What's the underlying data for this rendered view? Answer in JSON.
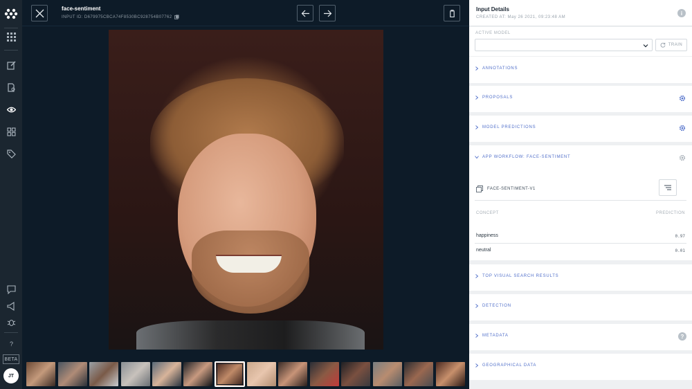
{
  "viewer": {
    "title": "face-sentiment",
    "input_id": "INPUT ID: D679975CBCA74F8530BC928754B07762"
  },
  "rail": {
    "beta_label": "BETA",
    "avatar_initials": "JT"
  },
  "panel": {
    "title": "Input Details",
    "created": "CREATED AT: May 26 2021, 09:23:48 AM",
    "active_model_label": "ACTIVE MODEL",
    "active_model_value": "",
    "train_label": "TRAIN",
    "sections": {
      "annotations": "ANNOTATIONS",
      "proposals": "PROPOSALS",
      "model_predictions": "MODEL PREDICTIONS",
      "app_workflow": "APP WORKFLOW: FACE-SENTIMENT",
      "top_visual_search": "TOP VISUAL SEARCH RESULTS",
      "detection": "DETECTION",
      "metadata": "METADATA",
      "geographical": "GEOGRAPHICAL DATA"
    },
    "workflow": {
      "model_name": "FACE-SENTIMENT-V1",
      "concept_header": "CONCEPT",
      "prediction_header": "PREDICTION",
      "rows": [
        {
          "concept": "happiness",
          "prediction": "0.97"
        },
        {
          "concept": "neutral",
          "prediction": "0.01"
        }
      ]
    }
  },
  "colors": {
    "rail_bg": "#1b2630",
    "viewer_bg": "#0d1b28",
    "panel_bg": "#eef0f2",
    "accent": "#4f6ec9"
  },
  "thumbnails_count": 15,
  "active_thumbnail_index": 6
}
